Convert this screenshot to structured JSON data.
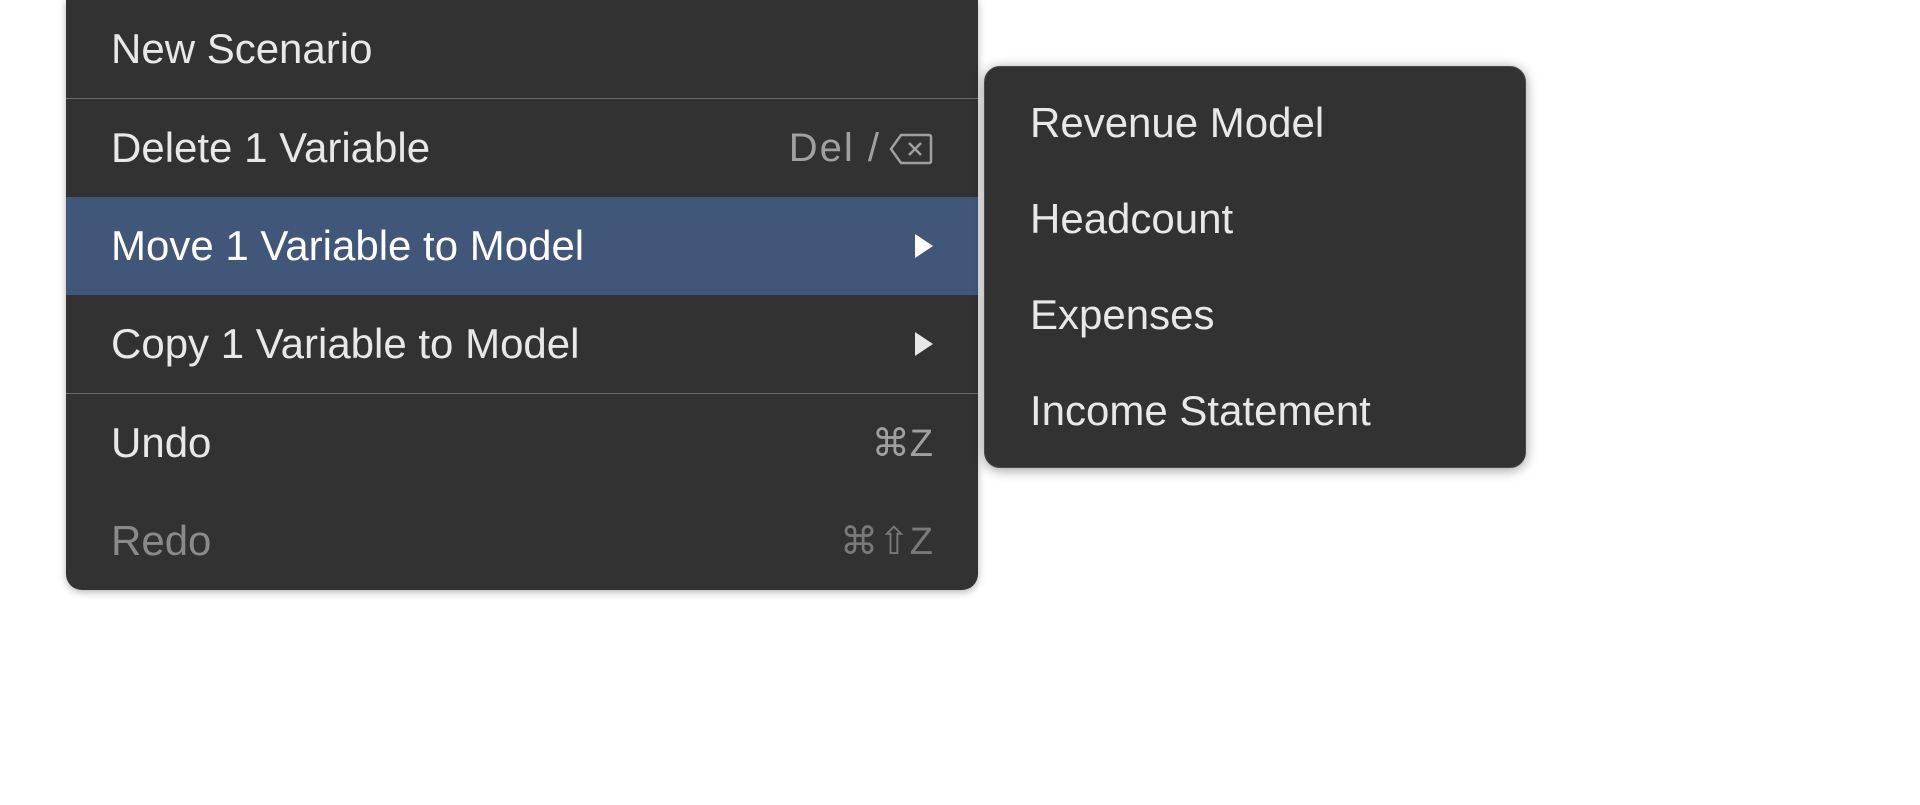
{
  "contextMenu": {
    "items": [
      {
        "label": "New Scenario"
      },
      {
        "label": "Delete 1 Variable",
        "shortcut": "Del / "
      },
      {
        "label": "Move 1 Variable to Model"
      },
      {
        "label": "Copy 1 Variable to Model"
      },
      {
        "label": "Undo",
        "shortcut": "⌘Z"
      },
      {
        "label": "Redo",
        "shortcut": "⌘⇧Z"
      }
    ]
  },
  "submenu": {
    "items": [
      {
        "label": "Revenue Model"
      },
      {
        "label": "Headcount"
      },
      {
        "label": "Expenses"
      },
      {
        "label": "Income Statement"
      }
    ]
  }
}
